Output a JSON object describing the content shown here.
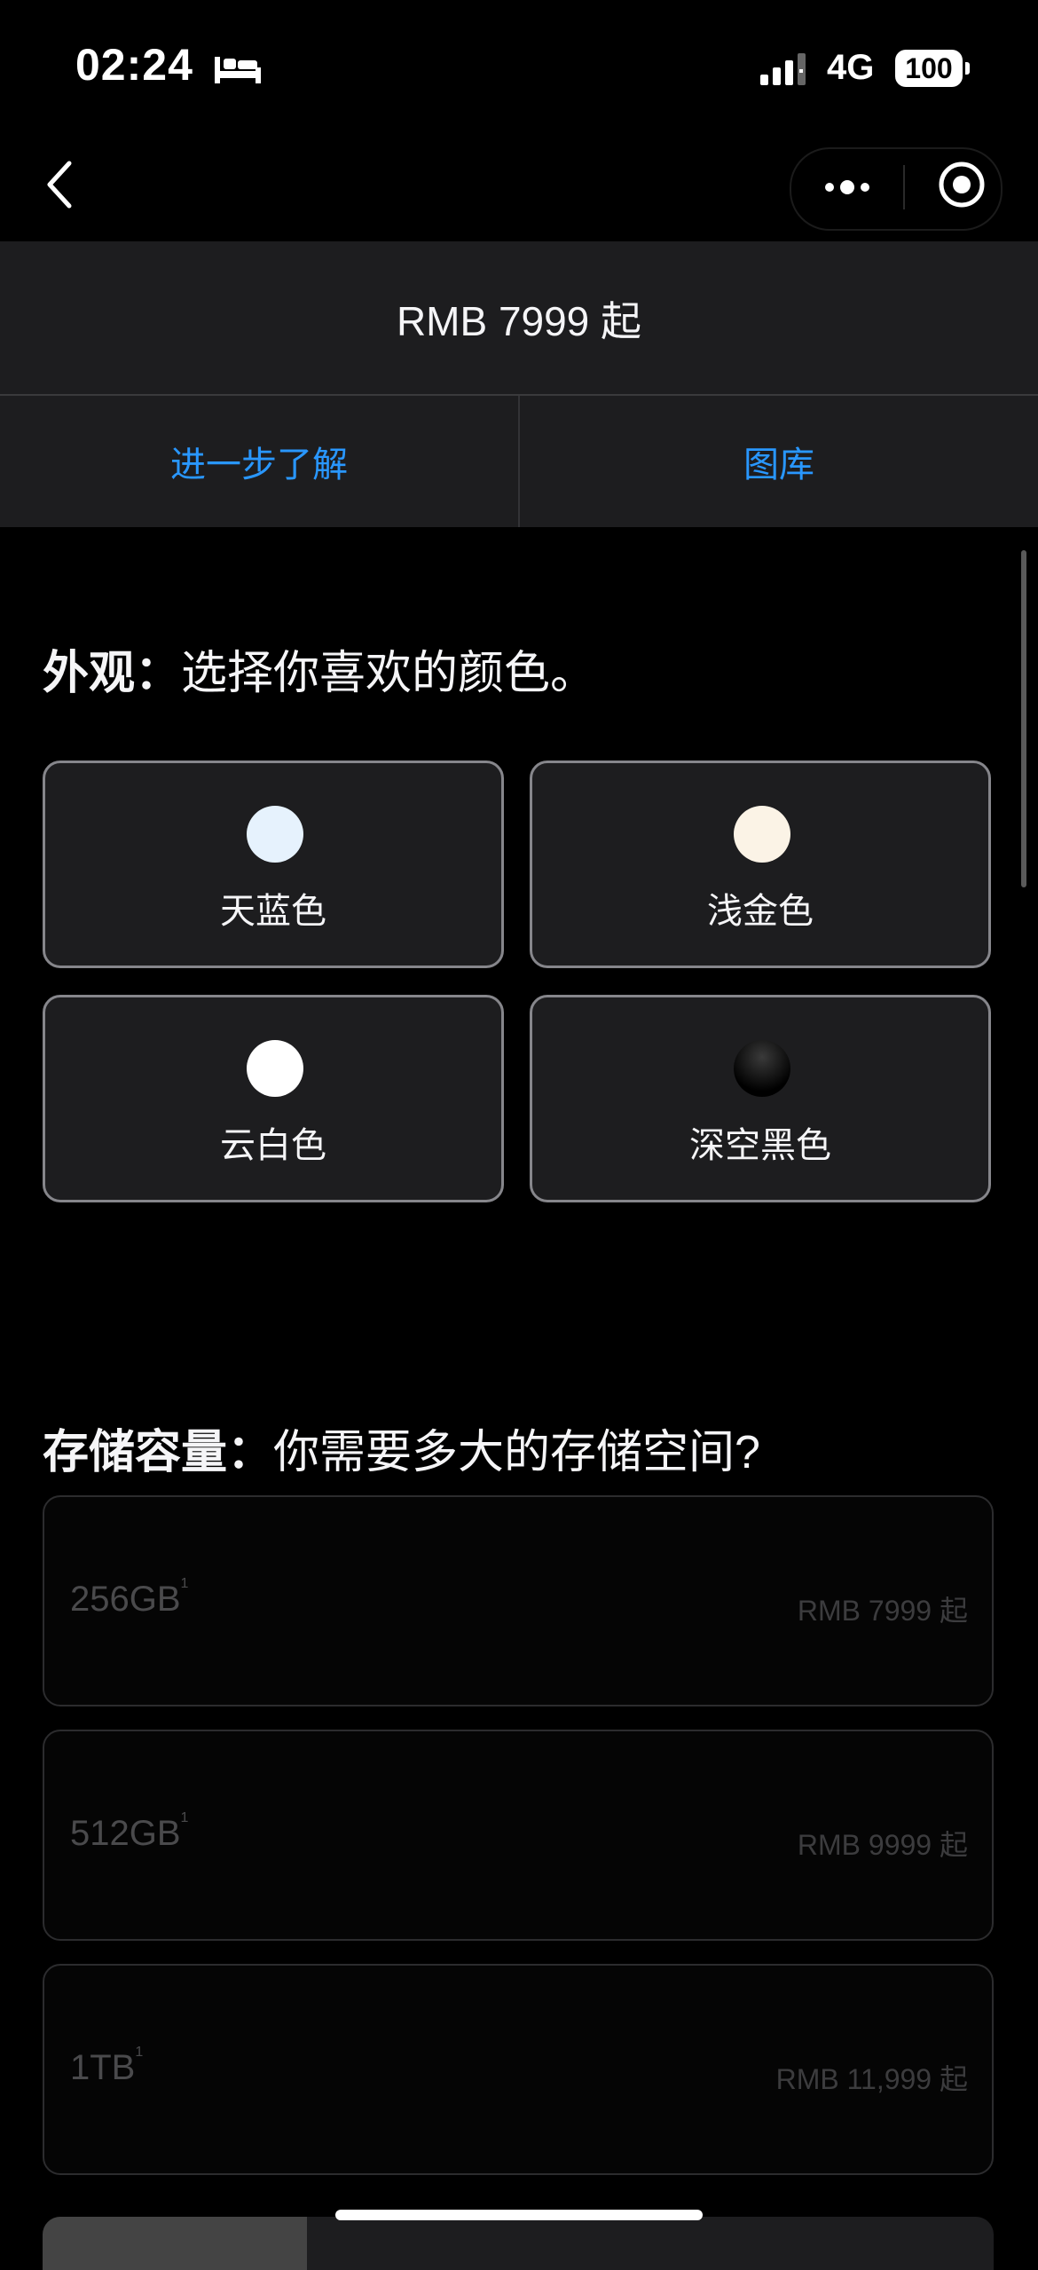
{
  "status_bar": {
    "time": "02:24",
    "network": "4G",
    "battery": "100"
  },
  "nav": {
    "back_icon": "chevron-left-icon",
    "more_icon": "more-dots-icon",
    "close_icon": "target-circle-icon"
  },
  "price_bar": {
    "price": "RMB 7999 起"
  },
  "tabs": [
    {
      "label": "进一步了解"
    },
    {
      "label": "图库"
    }
  ],
  "appearance": {
    "heading_bold": "外观：",
    "heading_rest": "选择你喜欢的颜色。",
    "colors": [
      {
        "label": "天蓝色",
        "swatch": "#e6f2fd"
      },
      {
        "label": "浅金色",
        "swatch": "#fbf3e6"
      },
      {
        "label": "云白色",
        "swatch": "#ffffff"
      },
      {
        "label": "深空黑色",
        "swatch": "#101010"
      }
    ]
  },
  "storage": {
    "heading_bold": "存储容量：",
    "heading_rest": "你需要多大的存储空间?",
    "options": [
      {
        "capacity": "256GB",
        "footnote": "1",
        "price": "RMB 7999 起"
      },
      {
        "capacity": "512GB",
        "footnote": "1",
        "price": "RMB 9999 起"
      },
      {
        "capacity": "1TB",
        "footnote": "1",
        "price": "RMB 11,999 起"
      }
    ]
  },
  "colors": {
    "accent": "#2997ff",
    "card_bg": "#1d1d1f",
    "card_border": "#86868b"
  }
}
